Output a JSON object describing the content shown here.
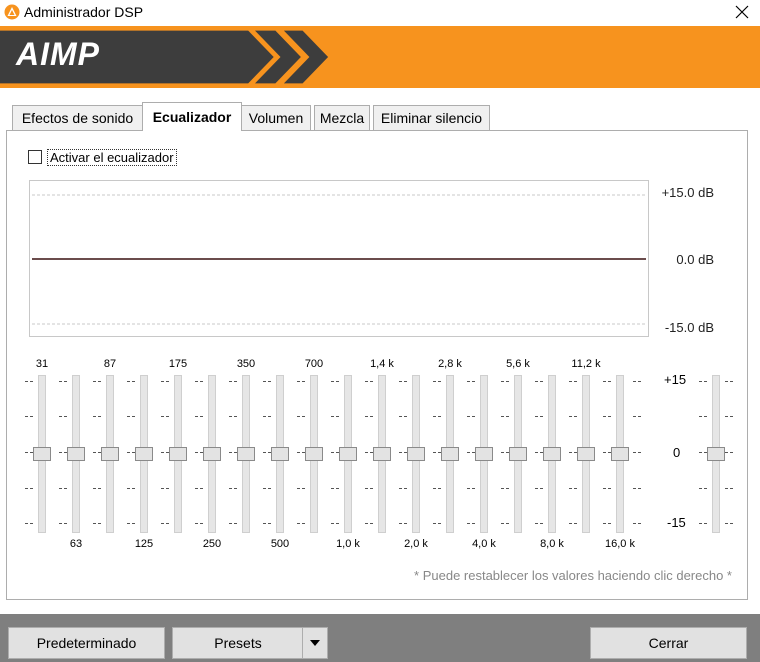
{
  "window": {
    "title": "Administrador DSP"
  },
  "brand": {
    "logo_text": "AIMP",
    "accent": "#f7931e",
    "dark": "#3d3d3d"
  },
  "tabs": [
    {
      "label": "Efectos de sonido",
      "active": false
    },
    {
      "label": "Ecualizador",
      "active": true
    },
    {
      "label": "Volumen",
      "active": false
    },
    {
      "label": "Mezcla",
      "active": false
    },
    {
      "label": "Eliminar silencio",
      "active": false
    }
  ],
  "equalizer": {
    "enable_label": "Activar el ecualizador",
    "enabled": false,
    "db_top": "+15.0 dB",
    "db_mid": "0.0 dB",
    "db_bottom": "-15.0 dB",
    "bands_top": [
      "31",
      "87",
      "175",
      "350",
      "700",
      "1,4 k",
      "2,8 k",
      "5,6 k",
      "11,2 k"
    ],
    "bands_bottom": [
      "63",
      "125",
      "250",
      "500",
      "1,0 k",
      "2,0 k",
      "4,0 k",
      "8,0 k",
      "16,0 k"
    ],
    "band_values_db": [
      0,
      0,
      0,
      0,
      0,
      0,
      0,
      0,
      0,
      0,
      0,
      0,
      0,
      0,
      0,
      0,
      0,
      0
    ],
    "preamp_db": 0,
    "scale_top": "+15",
    "scale_mid": "0",
    "scale_bottom": "-15",
    "hint": "* Puede restablecer los valores haciendo clic derecho *"
  },
  "footer": {
    "default_label": "Predeterminado",
    "presets_label": "Presets",
    "close_label": "Cerrar"
  }
}
